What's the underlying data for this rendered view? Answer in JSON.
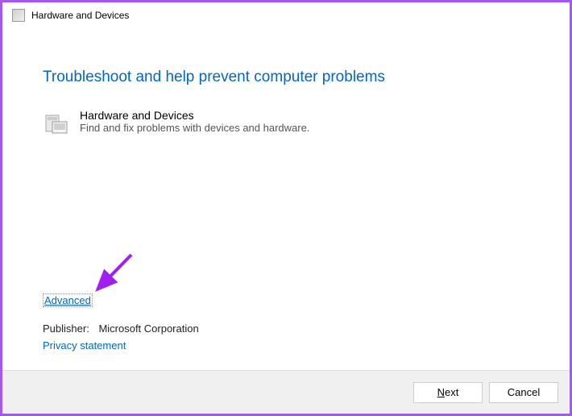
{
  "titlebar": {
    "title": "Hardware and Devices"
  },
  "heading": "Troubleshoot and help prevent computer problems",
  "troubleshooter": {
    "title": "Hardware and Devices",
    "description": "Find and fix problems with devices and hardware."
  },
  "links": {
    "advanced": "Advanced",
    "privacy": "Privacy statement"
  },
  "publisher": {
    "label": "Publisher:",
    "value": "Microsoft Corporation"
  },
  "buttons": {
    "next_prefix": "",
    "next_underline": "N",
    "next_suffix": "ext",
    "cancel": "Cancel"
  }
}
